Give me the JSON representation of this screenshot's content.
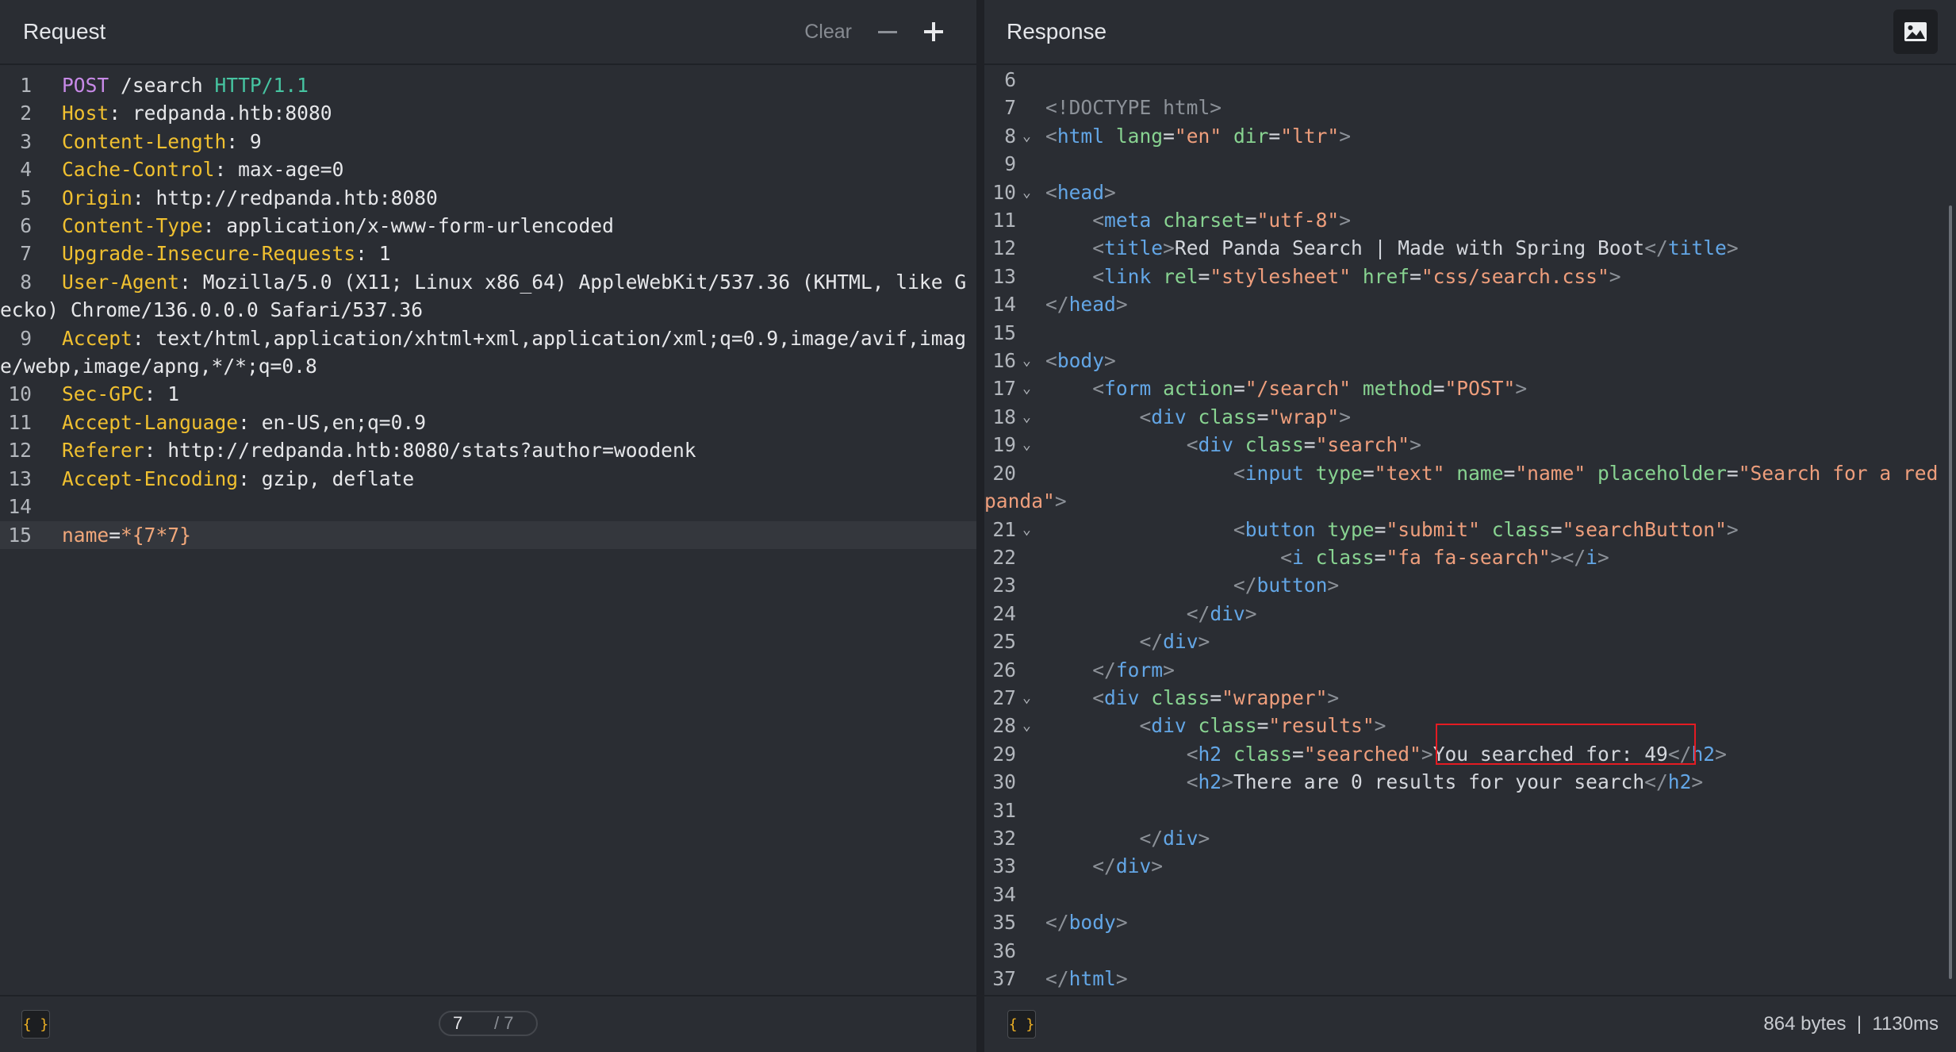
{
  "request": {
    "title": "Request",
    "clear_label": "Clear",
    "lines": [
      {
        "n": "1",
        "tokens": [
          [
            "method",
            "POST"
          ],
          [
            "path",
            " /search "
          ],
          [
            "proto",
            "HTTP/1.1"
          ]
        ]
      },
      {
        "n": "2",
        "tokens": [
          [
            "key",
            "Host"
          ],
          [
            "val",
            ": redpanda.htb:8080"
          ]
        ]
      },
      {
        "n": "3",
        "tokens": [
          [
            "key",
            "Content-Length"
          ],
          [
            "val",
            ": 9"
          ]
        ]
      },
      {
        "n": "4",
        "tokens": [
          [
            "key",
            "Cache-Control"
          ],
          [
            "val",
            ": max-age=0"
          ]
        ]
      },
      {
        "n": "5",
        "tokens": [
          [
            "key",
            "Origin"
          ],
          [
            "val",
            ": http://redpanda.htb:8080"
          ]
        ]
      },
      {
        "n": "6",
        "tokens": [
          [
            "key",
            "Content-Type"
          ],
          [
            "val",
            ": application/x-www-form-urlencoded"
          ]
        ]
      },
      {
        "n": "7",
        "tokens": [
          [
            "key",
            "Upgrade-Insecure-Requests"
          ],
          [
            "val",
            ": 1"
          ]
        ]
      },
      {
        "n": "8",
        "tokens": [
          [
            "key",
            "User-Agent"
          ],
          [
            "val",
            ": Mozilla/5.0 (X11; Linux x86_64) AppleWebKit/537.36 (KHTML, like Gecko) Chrome/136.0.0.0 Safari/537.36"
          ]
        ]
      },
      {
        "n": "9",
        "tokens": [
          [
            "key",
            "Accept"
          ],
          [
            "val",
            ": text/html,application/xhtml+xml,application/xml;q=0.9,image/avif,image/webp,image/apng,*/*;q=0.8"
          ]
        ]
      },
      {
        "n": "10",
        "tokens": [
          [
            "key",
            "Sec-GPC"
          ],
          [
            "val",
            ": 1"
          ]
        ]
      },
      {
        "n": "11",
        "tokens": [
          [
            "key",
            "Accept-Language"
          ],
          [
            "val",
            ": en-US,en;q=0.9"
          ]
        ]
      },
      {
        "n": "12",
        "tokens": [
          [
            "key",
            "Referer"
          ],
          [
            "val",
            ": http://redpanda.htb:8080/stats?author=woodenk"
          ]
        ]
      },
      {
        "n": "13",
        "tokens": [
          [
            "key",
            "Accept-Encoding"
          ],
          [
            "val",
            ": gzip, deflate"
          ]
        ]
      },
      {
        "n": "14",
        "tokens": []
      },
      {
        "n": "15",
        "highlight": true,
        "tokens": [
          [
            "param",
            "name"
          ],
          [
            "eq",
            "="
          ],
          [
            "pval",
            "*{7*7}"
          ]
        ]
      }
    ],
    "footer": {
      "brace_icon": "{ }",
      "pager_current": "7",
      "pager_total": "/ 7"
    }
  },
  "response": {
    "title": "Response",
    "image_icon": "image-icon",
    "lines": [
      {
        "n": "6",
        "tokens": []
      },
      {
        "n": "7",
        "tokens": [
          [
            "p",
            "<!DOCTYPE html>"
          ]
        ]
      },
      {
        "n": "8",
        "fold": true,
        "tokens": [
          [
            "p",
            "<"
          ],
          [
            "tag",
            "html"
          ],
          [
            "t",
            " "
          ],
          [
            "attr",
            "lang"
          ],
          [
            "t",
            "="
          ],
          [
            "str",
            "\"en\""
          ],
          [
            "t",
            " "
          ],
          [
            "attr",
            "dir"
          ],
          [
            "t",
            "="
          ],
          [
            "str",
            "\"ltr\""
          ],
          [
            "p",
            ">"
          ]
        ]
      },
      {
        "n": "9",
        "tokens": []
      },
      {
        "n": "10",
        "fold": true,
        "tokens": [
          [
            "p",
            "<"
          ],
          [
            "tag",
            "head"
          ],
          [
            "p",
            ">"
          ]
        ]
      },
      {
        "n": "11",
        "tokens": [
          [
            "t",
            "    "
          ],
          [
            "p",
            "<"
          ],
          [
            "tag",
            "meta"
          ],
          [
            "t",
            " "
          ],
          [
            "attr",
            "charset"
          ],
          [
            "t",
            "="
          ],
          [
            "str",
            "\"utf-8\""
          ],
          [
            "p",
            ">"
          ]
        ]
      },
      {
        "n": "12",
        "tokens": [
          [
            "t",
            "    "
          ],
          [
            "p",
            "<"
          ],
          [
            "tag",
            "title"
          ],
          [
            "p",
            ">"
          ],
          [
            "t",
            "Red Panda Search | Made with Spring Boot"
          ],
          [
            "p",
            "</"
          ],
          [
            "tag",
            "title"
          ],
          [
            "p",
            ">"
          ]
        ]
      },
      {
        "n": "13",
        "tokens": [
          [
            "t",
            "    "
          ],
          [
            "p",
            "<"
          ],
          [
            "tag",
            "link"
          ],
          [
            "t",
            " "
          ],
          [
            "attr",
            "rel"
          ],
          [
            "t",
            "="
          ],
          [
            "str",
            "\"stylesheet\""
          ],
          [
            "t",
            " "
          ],
          [
            "attr",
            "href"
          ],
          [
            "t",
            "="
          ],
          [
            "str",
            "\"css/search.css\""
          ],
          [
            "p",
            ">"
          ]
        ]
      },
      {
        "n": "14",
        "tokens": [
          [
            "p",
            "</"
          ],
          [
            "tag",
            "head"
          ],
          [
            "p",
            ">"
          ]
        ]
      },
      {
        "n": "15",
        "tokens": []
      },
      {
        "n": "16",
        "fold": true,
        "tokens": [
          [
            "p",
            "<"
          ],
          [
            "tag",
            "body"
          ],
          [
            "p",
            ">"
          ]
        ]
      },
      {
        "n": "17",
        "fold": true,
        "tokens": [
          [
            "t",
            "    "
          ],
          [
            "p",
            "<"
          ],
          [
            "tag",
            "form"
          ],
          [
            "t",
            " "
          ],
          [
            "attr",
            "action"
          ],
          [
            "t",
            "="
          ],
          [
            "str",
            "\"/search\""
          ],
          [
            "t",
            " "
          ],
          [
            "attr",
            "method"
          ],
          [
            "t",
            "="
          ],
          [
            "str",
            "\"POST\""
          ],
          [
            "p",
            ">"
          ]
        ]
      },
      {
        "n": "18",
        "fold": true,
        "tokens": [
          [
            "t",
            "        "
          ],
          [
            "p",
            "<"
          ],
          [
            "tag",
            "div"
          ],
          [
            "t",
            " "
          ],
          [
            "attr",
            "class"
          ],
          [
            "t",
            "="
          ],
          [
            "str",
            "\"wrap\""
          ],
          [
            "p",
            ">"
          ]
        ]
      },
      {
        "n": "19",
        "fold": true,
        "tokens": [
          [
            "t",
            "            "
          ],
          [
            "p",
            "<"
          ],
          [
            "tag",
            "div"
          ],
          [
            "t",
            " "
          ],
          [
            "attr",
            "class"
          ],
          [
            "t",
            "="
          ],
          [
            "str",
            "\"search\""
          ],
          [
            "p",
            ">"
          ]
        ]
      },
      {
        "n": "20",
        "tokens": [
          [
            "t",
            "                "
          ],
          [
            "p",
            "<"
          ],
          [
            "tag",
            "input"
          ],
          [
            "t",
            " "
          ],
          [
            "attr",
            "type"
          ],
          [
            "t",
            "="
          ],
          [
            "str",
            "\"text\""
          ],
          [
            "t",
            " "
          ],
          [
            "attr",
            "name"
          ],
          [
            "t",
            "="
          ],
          [
            "str",
            "\"name\""
          ],
          [
            "t",
            " "
          ],
          [
            "attr",
            "placeholder"
          ],
          [
            "t",
            "="
          ],
          [
            "str",
            "\"Search for a red panda\""
          ],
          [
            "p",
            ">"
          ]
        ]
      },
      {
        "n": "21",
        "fold": true,
        "tokens": [
          [
            "t",
            "                "
          ],
          [
            "p",
            "<"
          ],
          [
            "tag",
            "button"
          ],
          [
            "t",
            " "
          ],
          [
            "attr",
            "type"
          ],
          [
            "t",
            "="
          ],
          [
            "str",
            "\"submit\""
          ],
          [
            "t",
            " "
          ],
          [
            "attr",
            "class"
          ],
          [
            "t",
            "="
          ],
          [
            "str",
            "\"searchButton\""
          ],
          [
            "p",
            ">"
          ]
        ]
      },
      {
        "n": "22",
        "tokens": [
          [
            "t",
            "                    "
          ],
          [
            "p",
            "<"
          ],
          [
            "tag",
            "i"
          ],
          [
            "t",
            " "
          ],
          [
            "attr",
            "class"
          ],
          [
            "t",
            "="
          ],
          [
            "str",
            "\"fa fa-search\""
          ],
          [
            "p",
            "></"
          ],
          [
            "tag",
            "i"
          ],
          [
            "p",
            ">"
          ]
        ]
      },
      {
        "n": "23",
        "tokens": [
          [
            "t",
            "                "
          ],
          [
            "p",
            "</"
          ],
          [
            "tag",
            "button"
          ],
          [
            "p",
            ">"
          ]
        ]
      },
      {
        "n": "24",
        "tokens": [
          [
            "t",
            "            "
          ],
          [
            "p",
            "</"
          ],
          [
            "tag",
            "div"
          ],
          [
            "p",
            ">"
          ]
        ]
      },
      {
        "n": "25",
        "tokens": [
          [
            "t",
            "        "
          ],
          [
            "p",
            "</"
          ],
          [
            "tag",
            "div"
          ],
          [
            "p",
            ">"
          ]
        ]
      },
      {
        "n": "26",
        "tokens": [
          [
            "t",
            "    "
          ],
          [
            "p",
            "</"
          ],
          [
            "tag",
            "form"
          ],
          [
            "p",
            ">"
          ]
        ]
      },
      {
        "n": "27",
        "fold": true,
        "tokens": [
          [
            "t",
            "    "
          ],
          [
            "p",
            "<"
          ],
          [
            "tag",
            "div"
          ],
          [
            "t",
            " "
          ],
          [
            "attr",
            "class"
          ],
          [
            "t",
            "="
          ],
          [
            "str",
            "\"wrapper\""
          ],
          [
            "p",
            ">"
          ]
        ]
      },
      {
        "n": "28",
        "fold": true,
        "tokens": [
          [
            "t",
            "        "
          ],
          [
            "p",
            "<"
          ],
          [
            "tag",
            "div"
          ],
          [
            "t",
            " "
          ],
          [
            "attr",
            "class"
          ],
          [
            "t",
            "="
          ],
          [
            "str",
            "\"results\""
          ],
          [
            "p",
            ">"
          ]
        ]
      },
      {
        "n": "29",
        "tokens": [
          [
            "t",
            "            "
          ],
          [
            "p",
            "<"
          ],
          [
            "tag",
            "h2"
          ],
          [
            "t",
            " "
          ],
          [
            "attr",
            "class"
          ],
          [
            "t",
            "="
          ],
          [
            "str",
            "\"searched\""
          ],
          [
            "p",
            ">"
          ],
          [
            "t",
            "You searched for: 49"
          ],
          [
            "p",
            "</"
          ],
          [
            "tag",
            "h2"
          ],
          [
            "p",
            ">"
          ]
        ]
      },
      {
        "n": "30",
        "tokens": [
          [
            "t",
            "            "
          ],
          [
            "p",
            "<"
          ],
          [
            "tag",
            "h2"
          ],
          [
            "p",
            ">"
          ],
          [
            "t",
            "There are 0 results for your search"
          ],
          [
            "p",
            "</"
          ],
          [
            "tag",
            "h2"
          ],
          [
            "p",
            ">"
          ]
        ]
      },
      {
        "n": "31",
        "tokens": []
      },
      {
        "n": "32",
        "tokens": [
          [
            "t",
            "        "
          ],
          [
            "p",
            "</"
          ],
          [
            "tag",
            "div"
          ],
          [
            "p",
            ">"
          ]
        ]
      },
      {
        "n": "33",
        "tokens": [
          [
            "t",
            "    "
          ],
          [
            "p",
            "</"
          ],
          [
            "tag",
            "div"
          ],
          [
            "p",
            ">"
          ]
        ]
      },
      {
        "n": "34",
        "tokens": []
      },
      {
        "n": "35",
        "tokens": [
          [
            "p",
            "</"
          ],
          [
            "tag",
            "body"
          ],
          [
            "p",
            ">"
          ]
        ]
      },
      {
        "n": "36",
        "tokens": []
      },
      {
        "n": "37",
        "tokens": [
          [
            "p",
            "</"
          ],
          [
            "tag",
            "html"
          ],
          [
            "p",
            ">"
          ]
        ]
      }
    ],
    "footer": {
      "brace_icon": "{ }",
      "size": "864 bytes",
      "separator": "|",
      "time": "1130ms"
    }
  },
  "colors": {
    "background": "#2a2d33",
    "highlight_box": "#e41b22",
    "method": "#c88ae8",
    "protocol": "#46c4a1",
    "header_key": "#f0c030",
    "tag": "#63a6e6",
    "attr": "#88d391",
    "string": "#ee9e7c"
  }
}
